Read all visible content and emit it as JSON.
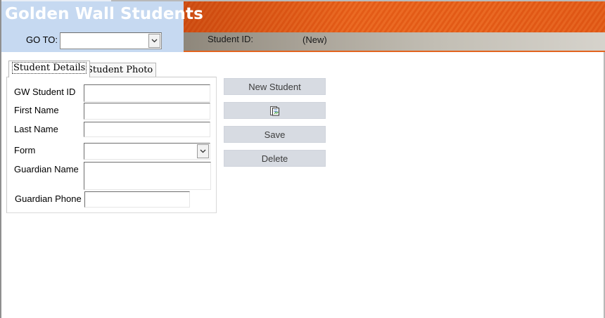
{
  "header": {
    "app_title": "Golden Wall Students",
    "goto_label": "GO TO:",
    "goto_value": "",
    "student_id_label": "Student ID:",
    "student_id_value": "(New)"
  },
  "tabs": [
    {
      "label": "Student Details",
      "selected": true
    },
    {
      "label": "Student Photo",
      "selected": false
    }
  ],
  "form": {
    "fields": [
      {
        "label": "GW Student ID",
        "value": ""
      },
      {
        "label": "First Name",
        "value": ""
      },
      {
        "label": "Last Name",
        "value": ""
      },
      {
        "label": "Form",
        "value": "",
        "type": "combo"
      },
      {
        "label": "Guardian Name",
        "value": ""
      },
      {
        "label": "Guardian Phone",
        "value": ""
      }
    ]
  },
  "actions": {
    "new_student": "New Student",
    "report_icon": "report-icon",
    "save": "Save",
    "delete": "Delete"
  },
  "colors": {
    "header_left": "#c6d9f1",
    "header_stripe": "#e25a16",
    "button_bg": "#d7dbe2"
  }
}
